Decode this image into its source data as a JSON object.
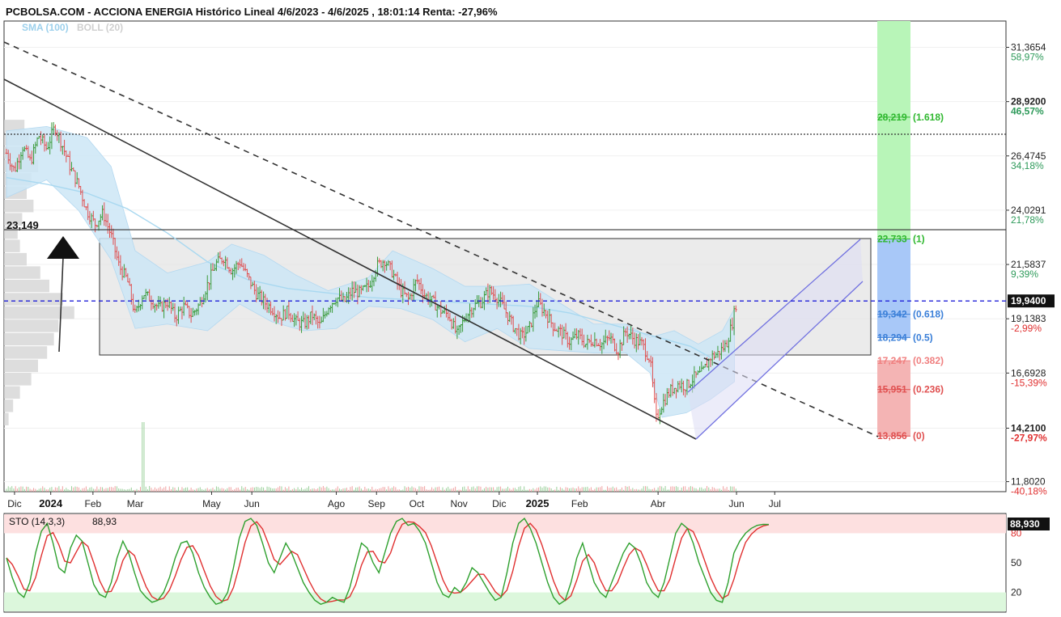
{
  "header": {
    "title": "PCBOLSA.COM - ACCIONA ENERGIA Histórico Lineal 4/6/2023 - 4/6/2025 , 18:01:14 Renta: -27,96%",
    "legend_sma": "SMA (100)",
    "legend_boll": "BOLL (20)"
  },
  "colors": {
    "bull": "#3a9a3a",
    "bear": "#e05050",
    "sma": "#a8d8f0",
    "boll_fill": "#cde6f6",
    "price_line": "#1f1fd8",
    "channel": "#7070e0",
    "fib_green": "#b8f5b8",
    "fib_blue": "#a8c8f8",
    "fib_red": "#f4b4b4",
    "sto_k": "#2ea02e",
    "sto_d": "#e03030"
  },
  "chart_data": [
    {
      "type": "line",
      "panel": "price",
      "y_range": [
        11.35,
        32.55
      ],
      "y_ticks": [
        {
          "value": 31.3654,
          "label": "31,3654",
          "pct": "58,97%",
          "pct_color": "#2e9a5a"
        },
        {
          "value": 28.92,
          "label": "28,9200",
          "pct": "46,57%",
          "pct_color": "#2e9a5a",
          "bold": true
        },
        {
          "value": 26.4745,
          "label": "26,4745",
          "pct": "34,18%",
          "pct_color": "#2e9a5a"
        },
        {
          "value": 24.0291,
          "label": "24,0291",
          "pct": "21,78%",
          "pct_color": "#2e9a5a"
        },
        {
          "value": 21.5837,
          "label": "21,5837",
          "pct": "9,39%",
          "pct_color": "#2e9a5a"
        },
        {
          "value": 19.1383,
          "label": "19,1383",
          "pct": "-2,99%",
          "pct_color": "#e03030"
        },
        {
          "value": 16.6928,
          "label": "16,6928",
          "pct": "-15,39%",
          "pct_color": "#e03030"
        },
        {
          "value": 14.21,
          "label": "14,2100",
          "pct": "-27,97%",
          "pct_color": "#e03030",
          "bold": true
        },
        {
          "value": 11.802,
          "label": "11,8020",
          "pct": "-40,18%",
          "pct_color": "#e03030"
        }
      ],
      "x_ticks": [
        {
          "label": "Dic",
          "month_index": 0.2
        },
        {
          "label": "2024",
          "month_index": 1.1,
          "bold": true
        },
        {
          "label": "Feb",
          "month_index": 2.15
        },
        {
          "label": "Mar",
          "month_index": 3.2
        },
        {
          "label": "May",
          "month_index": 5.1
        },
        {
          "label": "Jun",
          "month_index": 6.1
        },
        {
          "label": "Ago",
          "month_index": 8.2
        },
        {
          "label": "Sep",
          "month_index": 9.2
        },
        {
          "label": "Oct",
          "month_index": 10.2
        },
        {
          "label": "Nov",
          "month_index": 11.25
        },
        {
          "label": "Dic",
          "month_index": 12.25
        },
        {
          "label": "2025",
          "month_index": 13.2,
          "bold": true
        },
        {
          "label": "Feb",
          "month_index": 14.25
        },
        {
          "label": "Abr",
          "month_index": 16.2
        },
        {
          "label": "Jun",
          "month_index": 18.15
        },
        {
          "label": "Jul",
          "month_index": 19.1
        }
      ],
      "x_unit": "months since end of Nov 2023",
      "last_price": {
        "value": 19.94,
        "label": "19,9400",
        "month_index": 18.15
      },
      "level_23": {
        "value": 23.149,
        "label": "23,149"
      },
      "dotted_level": 27.45,
      "price_path": [
        [
          0.0,
          26.6
        ],
        [
          0.2,
          25.8
        ],
        [
          0.4,
          26.9
        ],
        [
          0.6,
          26.2
        ],
        [
          0.8,
          27.4
        ],
        [
          1.0,
          26.8
        ],
        [
          1.2,
          27.8
        ],
        [
          1.4,
          26.9
        ],
        [
          1.6,
          25.9
        ],
        [
          1.8,
          25.1
        ],
        [
          2.0,
          24.0
        ],
        [
          2.2,
          23.4
        ],
        [
          2.4,
          23.9
        ],
        [
          2.6,
          22.9
        ],
        [
          2.8,
          21.5
        ],
        [
          3.0,
          20.9
        ],
        [
          3.2,
          19.3
        ],
        [
          3.4,
          20.3
        ],
        [
          3.6,
          20.0
        ],
        [
          3.8,
          19.6
        ],
        [
          4.0,
          19.9
        ],
        [
          4.2,
          19.2
        ],
        [
          4.4,
          19.7
        ],
        [
          4.6,
          19.3
        ],
        [
          4.8,
          19.8
        ],
        [
          5.0,
          20.7
        ],
        [
          5.2,
          21.6
        ],
        [
          5.4,
          21.9
        ],
        [
          5.6,
          21.3
        ],
        [
          5.8,
          21.7
        ],
        [
          6.0,
          21.0
        ],
        [
          6.2,
          20.3
        ],
        [
          6.4,
          19.9
        ],
        [
          6.6,
          19.6
        ],
        [
          6.8,
          19.2
        ],
        [
          7.0,
          19.5
        ],
        [
          7.2,
          19.0
        ],
        [
          7.4,
          18.9
        ],
        [
          7.6,
          19.3
        ],
        [
          7.8,
          18.8
        ],
        [
          8.0,
          19.7
        ],
        [
          8.2,
          20.1
        ],
        [
          8.4,
          19.9
        ],
        [
          8.6,
          20.4
        ],
        [
          8.8,
          20.3
        ],
        [
          9.0,
          20.6
        ],
        [
          9.2,
          21.5
        ],
        [
          9.4,
          21.8
        ],
        [
          9.6,
          21.2
        ],
        [
          9.8,
          20.4
        ],
        [
          10.0,
          20.0
        ],
        [
          10.2,
          20.9
        ],
        [
          10.4,
          20.2
        ],
        [
          10.6,
          19.9
        ],
        [
          10.8,
          19.5
        ],
        [
          11.0,
          19.3
        ],
        [
          11.2,
          18.4
        ],
        [
          11.4,
          19.2
        ],
        [
          11.6,
          19.7
        ],
        [
          11.8,
          19.9
        ],
        [
          12.0,
          20.4
        ],
        [
          12.2,
          20.1
        ],
        [
          12.4,
          19.5
        ],
        [
          12.6,
          18.8
        ],
        [
          12.8,
          18.3
        ],
        [
          13.0,
          18.7
        ],
        [
          13.2,
          19.9
        ],
        [
          13.4,
          19.4
        ],
        [
          13.6,
          18.8
        ],
        [
          13.8,
          18.5
        ],
        [
          14.0,
          18.1
        ],
        [
          14.2,
          18.4
        ],
        [
          14.4,
          18.0
        ],
        [
          14.6,
          18.2
        ],
        [
          14.8,
          18.0
        ],
        [
          15.0,
          18.3
        ],
        [
          15.2,
          17.7
        ],
        [
          15.4,
          18.6
        ],
        [
          15.6,
          18.2
        ],
        [
          15.8,
          18.0
        ],
        [
          16.0,
          17.3
        ],
        [
          16.15,
          14.6
        ],
        [
          16.3,
          15.3
        ],
        [
          16.5,
          15.9
        ],
        [
          16.7,
          16.2
        ],
        [
          16.9,
          16.1
        ],
        [
          17.1,
          16.5
        ],
        [
          17.3,
          16.7
        ],
        [
          17.5,
          17.4
        ],
        [
          17.7,
          17.6
        ],
        [
          17.9,
          18.0
        ],
        [
          18.05,
          19.0
        ],
        [
          18.15,
          19.94
        ]
      ],
      "sma_path": [
        [
          0.0,
          25.5
        ],
        [
          1.0,
          25.2
        ],
        [
          2.0,
          24.8
        ],
        [
          3.0,
          24.1
        ],
        [
          4.0,
          23.0
        ],
        [
          5.0,
          21.7
        ],
        [
          6.0,
          20.9
        ],
        [
          7.0,
          20.5
        ],
        [
          8.0,
          20.3
        ],
        [
          9.0,
          20.1
        ],
        [
          10.0,
          20.0
        ],
        [
          11.0,
          19.9
        ],
        [
          12.0,
          19.8
        ],
        [
          13.0,
          19.7
        ],
        [
          14.0,
          19.4
        ],
        [
          15.0,
          18.9
        ],
        [
          16.0,
          18.4
        ],
        [
          17.0,
          17.9
        ],
        [
          17.5,
          17.4
        ]
      ],
      "boll_upper": [
        [
          0.0,
          27.6
        ],
        [
          1.0,
          27.8
        ],
        [
          2.0,
          27.3
        ],
        [
          2.6,
          26.0
        ],
        [
          3.2,
          22.2
        ],
        [
          4.0,
          21.2
        ],
        [
          5.0,
          21.7
        ],
        [
          5.6,
          22.5
        ],
        [
          6.4,
          22.0
        ],
        [
          7.2,
          21.1
        ],
        [
          8.0,
          20.4
        ],
        [
          9.0,
          21.0
        ],
        [
          9.6,
          22.2
        ],
        [
          10.6,
          21.4
        ],
        [
          11.4,
          20.6
        ],
        [
          12.2,
          20.6
        ],
        [
          13.0,
          20.7
        ],
        [
          13.8,
          19.8
        ],
        [
          14.6,
          18.9
        ],
        [
          15.4,
          18.9
        ],
        [
          16.0,
          18.3
        ],
        [
          16.6,
          18.6
        ],
        [
          17.2,
          18.0
        ],
        [
          17.8,
          18.6
        ],
        [
          18.1,
          19.6
        ]
      ],
      "boll_lower": [
        [
          0.0,
          24.6
        ],
        [
          1.0,
          25.4
        ],
        [
          1.8,
          24.0
        ],
        [
          2.6,
          21.8
        ],
        [
          3.2,
          18.7
        ],
        [
          4.0,
          18.9
        ],
        [
          5.0,
          18.6
        ],
        [
          5.8,
          19.8
        ],
        [
          6.6,
          19.0
        ],
        [
          7.4,
          18.6
        ],
        [
          8.2,
          18.7
        ],
        [
          9.0,
          19.7
        ],
        [
          9.8,
          19.6
        ],
        [
          10.6,
          19.1
        ],
        [
          11.4,
          18.1
        ],
        [
          12.2,
          18.7
        ],
        [
          13.0,
          17.8
        ],
        [
          13.8,
          17.7
        ],
        [
          14.6,
          17.6
        ],
        [
          15.4,
          17.6
        ],
        [
          16.0,
          16.7
        ],
        [
          16.3,
          14.7
        ],
        [
          16.9,
          14.9
        ],
        [
          17.5,
          15.5
        ],
        [
          18.1,
          16.3
        ]
      ],
      "fibonacci": [
        {
          "value": 28.219,
          "label": "28,219",
          "ratio": "(1.618)",
          "color": "#2fb82f"
        },
        {
          "value": 22.733,
          "label": "22,733",
          "ratio": "(1)",
          "color": "#2fb82f"
        },
        {
          "value": 19.342,
          "label": "19,342",
          "ratio": "(0.618)",
          "color": "#3a7fd8"
        },
        {
          "value": 18.294,
          "label": "18,294",
          "ratio": "(0.5)",
          "color": "#3a7fd8"
        },
        {
          "value": 17.247,
          "label": "17,247",
          "ratio": "(0.382)",
          "color": "#f08080"
        },
        {
          "value": 15.951,
          "label": "15,951",
          "ratio": "(0.236)",
          "color": "#e05050"
        },
        {
          "value": 13.856,
          "label": "13,856",
          "ratio": "(0)",
          "color": "#e05050"
        }
      ]
    },
    {
      "type": "line",
      "panel": "stochastic",
      "title": "STO (14,3,3)",
      "current_value": {
        "value": 88.93,
        "label": "88,93",
        "axis_label": "88,930"
      },
      "y_range": [
        0,
        100
      ],
      "y_ticks": [
        {
          "value": 80,
          "label": "80",
          "color": "#e03030"
        },
        {
          "value": 50,
          "label": "50",
          "color": "#222222"
        },
        {
          "value": 20,
          "label": "20",
          "color": "#222222"
        }
      ],
      "k_values": [
        55,
        35,
        20,
        15,
        30,
        60,
        82,
        90,
        70,
        45,
        40,
        65,
        78,
        72,
        50,
        28,
        18,
        15,
        30,
        55,
        72,
        60,
        40,
        22,
        15,
        10,
        12,
        20,
        35,
        55,
        70,
        72,
        60,
        40,
        25,
        15,
        8,
        10,
        20,
        45,
        75,
        92,
        95,
        88,
        70,
        50,
        40,
        55,
        70,
        60,
        45,
        30,
        20,
        12,
        8,
        10,
        15,
        12,
        10,
        25,
        48,
        70,
        65,
        50,
        40,
        60,
        80,
        92,
        95,
        88,
        90,
        82,
        70,
        50,
        30,
        18,
        15,
        25,
        20,
        30,
        45,
        40,
        30,
        20,
        12,
        15,
        40,
        70,
        90,
        95,
        85,
        70,
        50,
        30,
        15,
        8,
        12,
        30,
        55,
        70,
        50,
        30,
        20,
        15,
        30,
        45,
        60,
        70,
        65,
        50,
        30,
        20,
        15,
        30,
        55,
        80,
        90,
        85,
        70,
        50,
        35,
        20,
        12,
        10,
        30,
        60,
        72,
        80,
        85,
        88,
        89,
        88.9
      ]
    }
  ]
}
